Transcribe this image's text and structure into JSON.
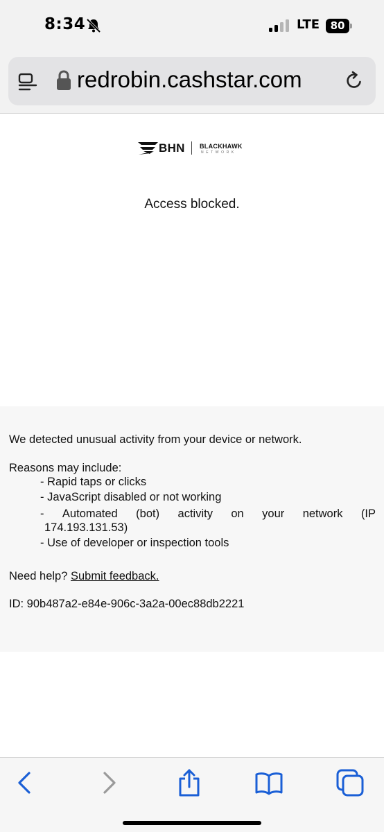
{
  "status_bar": {
    "time": "8:34",
    "network": "LTE",
    "battery": "80",
    "icons": [
      "bell-slash-icon",
      "signal-icon",
      "battery-icon"
    ]
  },
  "browser": {
    "url": "redrobin.cashstar.com",
    "icons": [
      "reader-icon",
      "lock-icon",
      "reload-icon"
    ]
  },
  "page": {
    "logo": {
      "brand": "BHN",
      "company": "BLACKHAWK",
      "tagline": "NETWORK"
    },
    "headline": "Access blocked.",
    "message": "We detected unusual activity from your device or network.",
    "reasons_title": "Reasons may include:",
    "reasons": [
      "- Rapid taps or clicks",
      "- JavaScript disabled or not working",
      "- Automated (bot) activity on your network (IP 174.193.131.53)",
      "- Use of developer or inspection tools"
    ],
    "reason_3_line1_words": [
      "-",
      "Automated",
      "(bot)",
      "activity",
      "on",
      "your",
      "network",
      "(IP"
    ],
    "reason_3_line2": "174.193.131.53)",
    "help_prefix": "Need help?",
    "help_link": "Submit feedback.",
    "id_line": "ID: 90b487a2-e84e-906c-3a2a-00ec88db2221"
  },
  "toolbar": {
    "icons": [
      "back-icon",
      "forward-icon",
      "share-icon",
      "bookmarks-icon",
      "tabs-icon"
    ],
    "colors": {
      "active": "#1a5fd6",
      "disabled": "#9a9a9a"
    }
  }
}
